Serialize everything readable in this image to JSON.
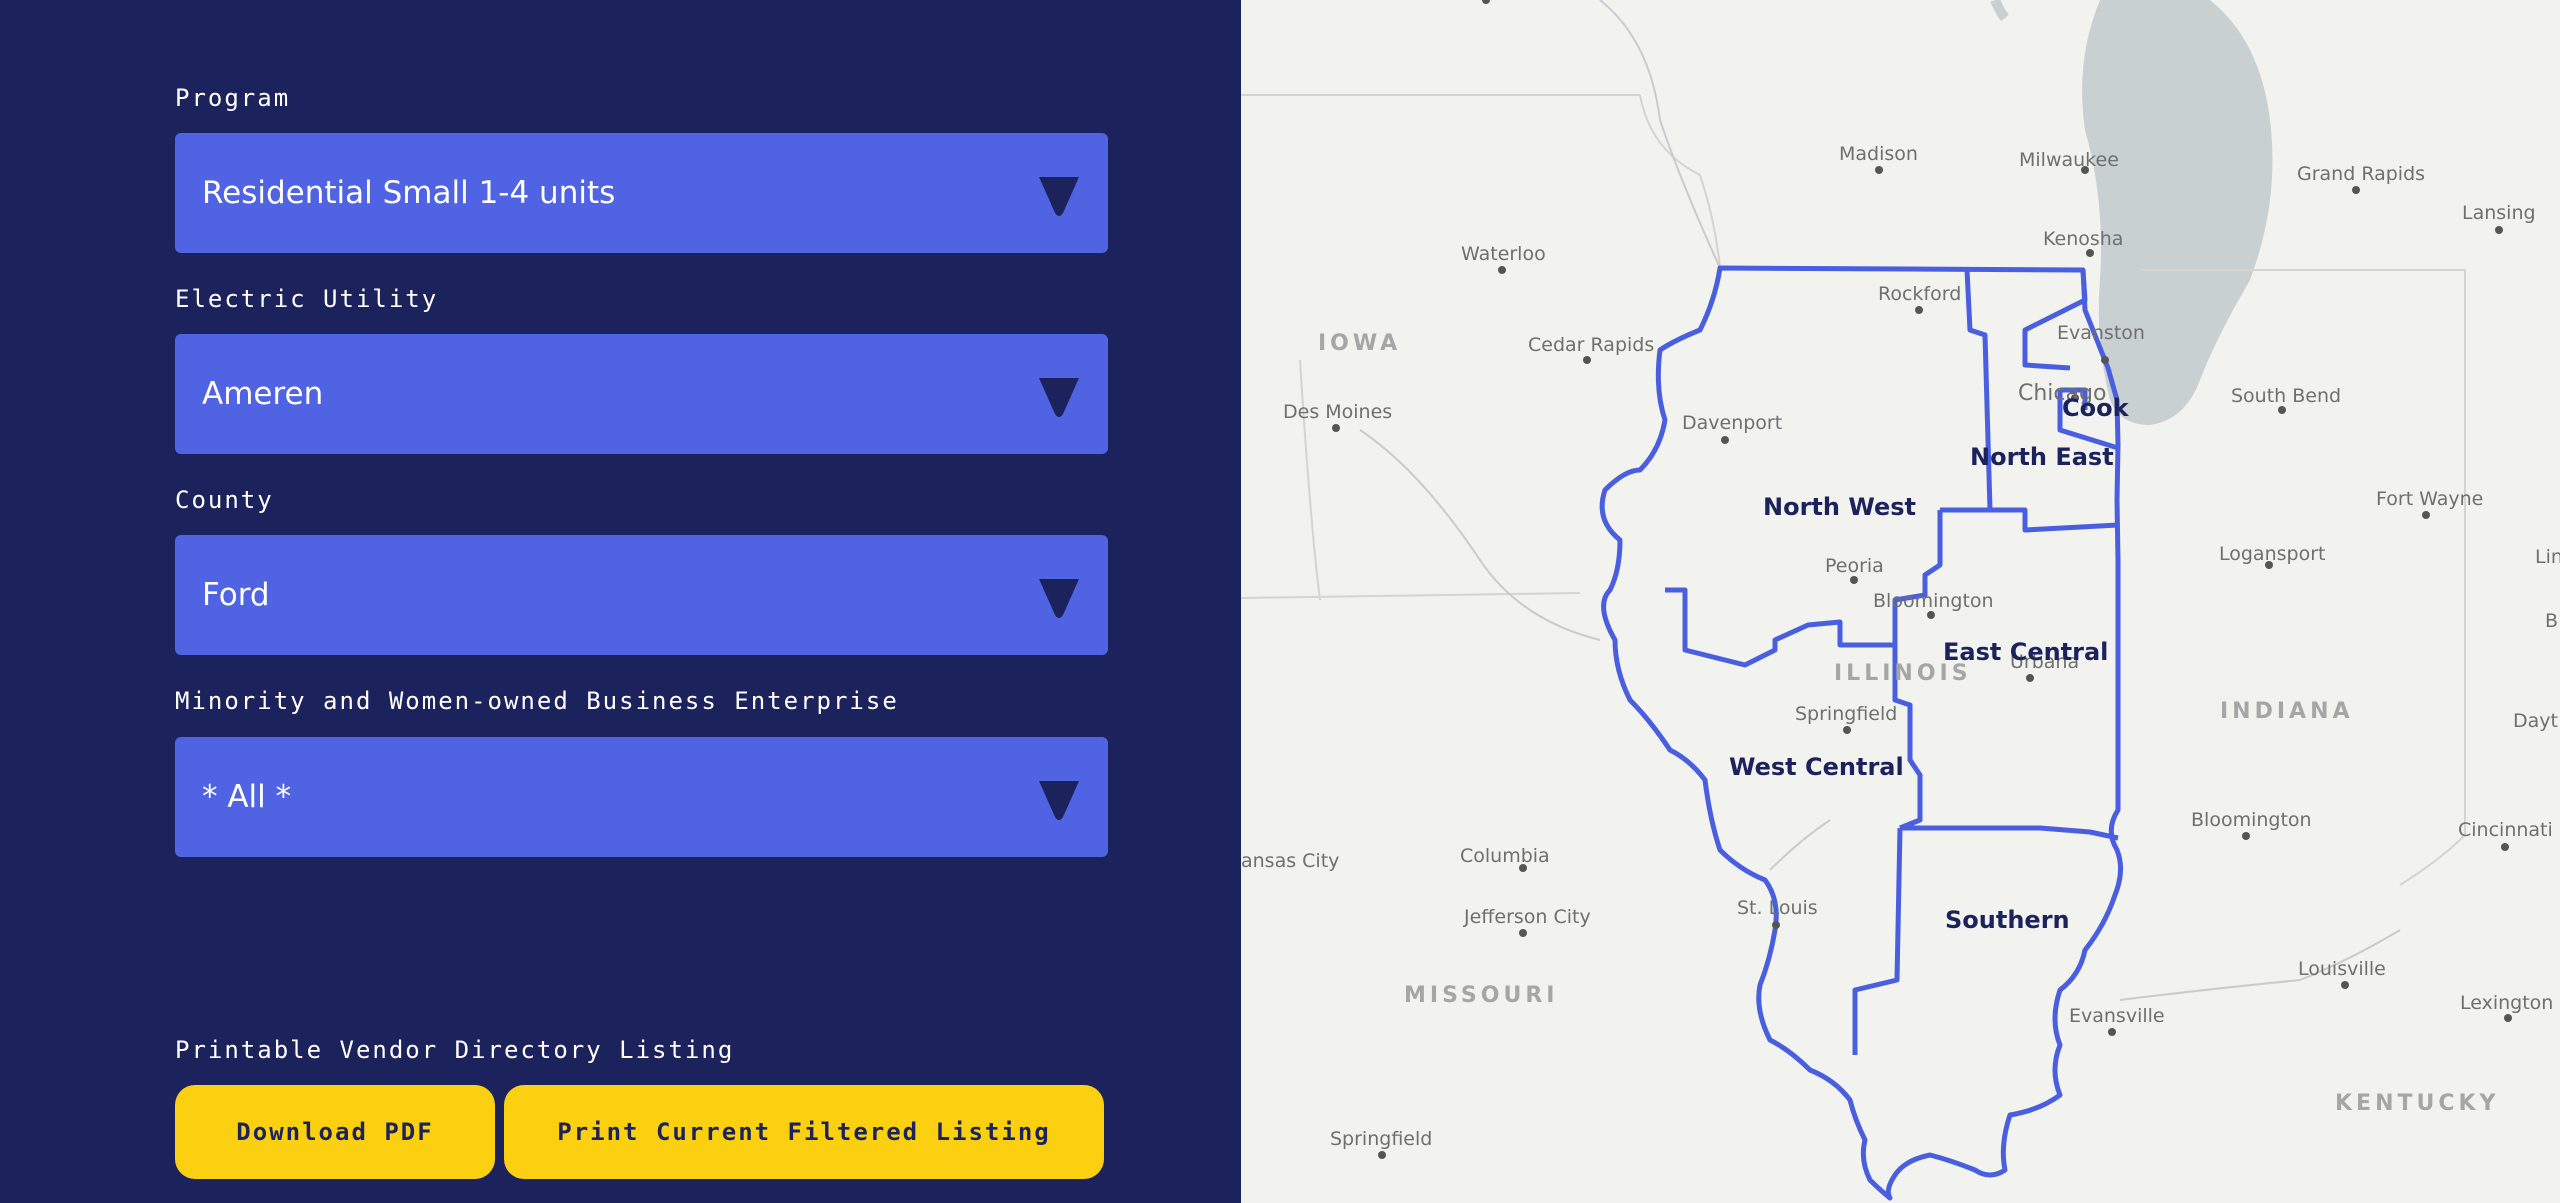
{
  "filters": {
    "program": {
      "label": "Program",
      "value": "Residential Small 1-4 units"
    },
    "utility": {
      "label": "Electric Utility",
      "value": "Ameren"
    },
    "county": {
      "label": "County",
      "value": "Ford"
    },
    "mwbe": {
      "label": "Minority and Women-owned Business Enterprise",
      "value": "* All *"
    }
  },
  "printable": {
    "label": "Printable Vendor Directory Listing",
    "download_label": "Download PDF",
    "print_label": "Print Current Filtered Listing"
  },
  "map": {
    "states": [
      "IOWA",
      "ILLINOIS",
      "INDIANA",
      "MISSOURI",
      "KENTUCKY"
    ],
    "cities": [
      "Madison",
      "Milwaukee",
      "Grand Rapids",
      "Lansing",
      "Kenosha",
      "Waterloo",
      "Rockford",
      "Evanston",
      "Cedar Rapids",
      "Chicago",
      "South Bend",
      "Des Moines",
      "Davenport",
      "Fort Wayne",
      "Logansport",
      "Peoria",
      "Bloomington",
      "Urbana",
      "Springfield",
      "Dayt",
      "Bloomington",
      "Cincinnati",
      "ansas City",
      "Columbia",
      "St. Louis",
      "Jefferson City",
      "Louisville",
      "Evansville",
      "Lexington",
      "Springfield",
      "Lin",
      "B"
    ],
    "regions": [
      "Cook",
      "North East",
      "North West",
      "East Central",
      "West Central",
      "Southern"
    ]
  },
  "colors": {
    "sidebar_bg": "#1c235c",
    "select_bg": "#5063e3",
    "button_bg": "#fbd011",
    "region_border": "#4a5ee0",
    "lake": "#c9d0d1"
  }
}
